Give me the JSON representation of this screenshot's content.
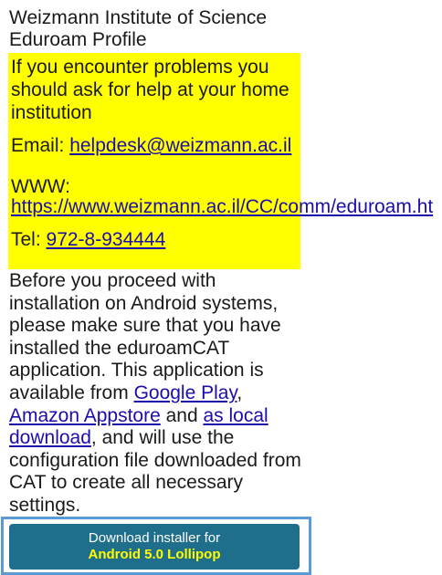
{
  "profile": {
    "institution": "Weizmann Institute of Science",
    "profile_name": "Eduroam Profile"
  },
  "help": {
    "message": "If you encounter problems you\nshould ask for help at your home\ninstitution",
    "email_label": "Email: ",
    "email": "helpdesk@weizmann.ac.il",
    "www_label": "WWW:",
    "www_url": "https://www.weizmann.ac.il/CC/comm/eduroam.ht",
    "tel_label": "Tel: ",
    "tel": "972-8-934444",
    "highlight_color": "#ffff00"
  },
  "description": {
    "text_before": "Before you proceed with installation on Android systems, please make sure that you have installed the eduroamCAT application. This application is available from ",
    "google_play": "Google Play",
    "sep1": ", ",
    "amazon": "Amazon Appstore",
    "sep2": " and ",
    "local_download": "as local download",
    "text_after": ", and will use the configuration file downloaded from CAT to create all necessary settings."
  },
  "download": {
    "line1": "Download installer for",
    "line2": "Android 5.0 Lollipop",
    "button_color": "#1f6e8c",
    "frame_color": "#5b9bd5"
  }
}
